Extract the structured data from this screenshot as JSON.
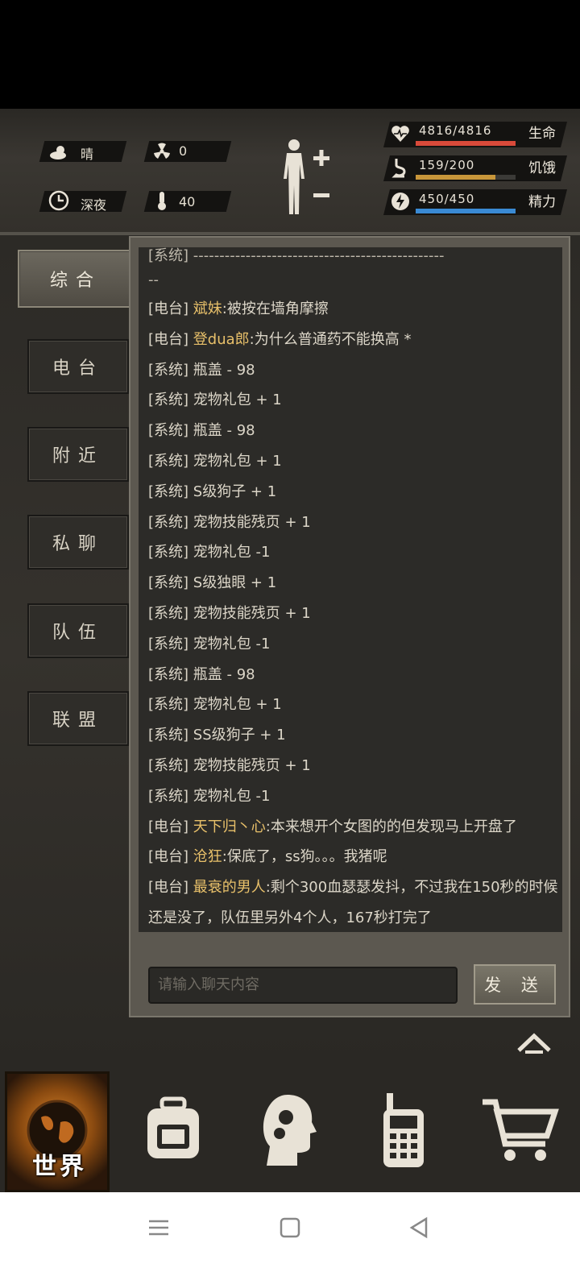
{
  "hud": {
    "weather": "晴",
    "radiation": "0",
    "time_of_day": "深夜",
    "temperature": "40",
    "stats": [
      {
        "label": "生命",
        "value": "4816/4816",
        "fill": 1.0,
        "color": "#d94a3a",
        "icon": "heart-icon"
      },
      {
        "label": "饥饿",
        "value": "159/200",
        "fill": 0.795,
        "color": "#c8963a",
        "icon": "stomach-icon"
      },
      {
        "label": "精力",
        "value": "450/450",
        "fill": 1.0,
        "color": "#3a8ad4",
        "icon": "energy-icon"
      }
    ]
  },
  "tabs": [
    {
      "label": "综合",
      "active": true
    },
    {
      "label": "电台",
      "active": false
    },
    {
      "label": "附近",
      "active": false
    },
    {
      "label": "私聊",
      "active": false
    },
    {
      "label": "队伍",
      "active": false
    },
    {
      "label": "联盟",
      "active": false
    }
  ],
  "chat": {
    "partial_top": "[系统] ------------------------------------------------",
    "partial_top_wrap": "--",
    "messages": [
      {
        "tag": "[电台]",
        "name": "斌妹",
        "text": ":被按在墙角摩擦"
      },
      {
        "tag": "[电台]",
        "name": "登dua郎",
        "text": ":为什么普通药不能换高 *"
      },
      {
        "tag": "[系统]",
        "name": "",
        "text": "瓶盖 - 98"
      },
      {
        "tag": "[系统]",
        "name": "",
        "text": "宠物礼包 + 1"
      },
      {
        "tag": "[系统]",
        "name": "",
        "text": "瓶盖 - 98"
      },
      {
        "tag": "[系统]",
        "name": "",
        "text": "宠物礼包 + 1"
      },
      {
        "tag": "[系统]",
        "name": "",
        "text": "S级狗子 + 1"
      },
      {
        "tag": "[系统]",
        "name": "",
        "text": "宠物技能残页 + 1"
      },
      {
        "tag": "[系统]",
        "name": "",
        "text": "宠物礼包 -1"
      },
      {
        "tag": "[系统]",
        "name": "",
        "text": "S级独眼 + 1"
      },
      {
        "tag": "[系统]",
        "name": "",
        "text": "宠物技能残页 + 1"
      },
      {
        "tag": "[系统]",
        "name": "",
        "text": "宠物礼包 -1"
      },
      {
        "tag": "[系统]",
        "name": "",
        "text": "瓶盖 - 98"
      },
      {
        "tag": "[系统]",
        "name": "",
        "text": "宠物礼包 + 1"
      },
      {
        "tag": "[系统]",
        "name": "",
        "text": "SS级狗子 + 1"
      },
      {
        "tag": "[系统]",
        "name": "",
        "text": "宠物技能残页 + 1"
      },
      {
        "tag": "[系统]",
        "name": "",
        "text": "宠物礼包 -1"
      },
      {
        "tag": "[电台]",
        "name": "天下归丶心",
        "text": ":本来想开个女图的的但发现马上开盘了"
      },
      {
        "tag": "[电台]",
        "name": "沧狂",
        "text": ":保底了，ss狗。。。我猪呢"
      },
      {
        "tag": "[电台]",
        "name": "最衰的男人",
        "text": ":剩个300血瑟瑟发抖，不过我在150秒的时候还是没了，队伍里另外4个人，167秒打完了"
      }
    ],
    "input_placeholder": "请输入聊天内容",
    "send_label": "发 送"
  },
  "bottom_nav": [
    {
      "icon": "globe-icon",
      "label": "世界",
      "active": true
    },
    {
      "icon": "backpack-icon",
      "label": "",
      "active": false
    },
    {
      "icon": "brain-head-icon",
      "label": "",
      "active": false
    },
    {
      "icon": "walkie-talkie-icon",
      "label": "",
      "active": false
    },
    {
      "icon": "shopping-cart-icon",
      "label": "",
      "active": false
    }
  ]
}
